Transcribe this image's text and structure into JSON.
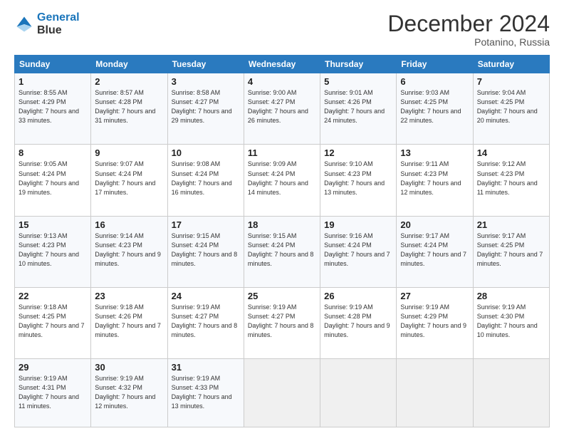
{
  "header": {
    "logo_line1": "General",
    "logo_line2": "Blue",
    "month": "December 2024",
    "location": "Potanino, Russia"
  },
  "days_of_week": [
    "Sunday",
    "Monday",
    "Tuesday",
    "Wednesday",
    "Thursday",
    "Friday",
    "Saturday"
  ],
  "weeks": [
    [
      {
        "day": "1",
        "sunrise": "8:55 AM",
        "sunset": "4:29 PM",
        "daylight": "7 hours and 33 minutes."
      },
      {
        "day": "2",
        "sunrise": "8:57 AM",
        "sunset": "4:28 PM",
        "daylight": "7 hours and 31 minutes."
      },
      {
        "day": "3",
        "sunrise": "8:58 AM",
        "sunset": "4:27 PM",
        "daylight": "7 hours and 29 minutes."
      },
      {
        "day": "4",
        "sunrise": "9:00 AM",
        "sunset": "4:27 PM",
        "daylight": "7 hours and 26 minutes."
      },
      {
        "day": "5",
        "sunrise": "9:01 AM",
        "sunset": "4:26 PM",
        "daylight": "7 hours and 24 minutes."
      },
      {
        "day": "6",
        "sunrise": "9:03 AM",
        "sunset": "4:25 PM",
        "daylight": "7 hours and 22 minutes."
      },
      {
        "day": "7",
        "sunrise": "9:04 AM",
        "sunset": "4:25 PM",
        "daylight": "7 hours and 20 minutes."
      }
    ],
    [
      {
        "day": "8",
        "sunrise": "9:05 AM",
        "sunset": "4:24 PM",
        "daylight": "7 hours and 19 minutes."
      },
      {
        "day": "9",
        "sunrise": "9:07 AM",
        "sunset": "4:24 PM",
        "daylight": "7 hours and 17 minutes."
      },
      {
        "day": "10",
        "sunrise": "9:08 AM",
        "sunset": "4:24 PM",
        "daylight": "7 hours and 16 minutes."
      },
      {
        "day": "11",
        "sunrise": "9:09 AM",
        "sunset": "4:24 PM",
        "daylight": "7 hours and 14 minutes."
      },
      {
        "day": "12",
        "sunrise": "9:10 AM",
        "sunset": "4:23 PM",
        "daylight": "7 hours and 13 minutes."
      },
      {
        "day": "13",
        "sunrise": "9:11 AM",
        "sunset": "4:23 PM",
        "daylight": "7 hours and 12 minutes."
      },
      {
        "day": "14",
        "sunrise": "9:12 AM",
        "sunset": "4:23 PM",
        "daylight": "7 hours and 11 minutes."
      }
    ],
    [
      {
        "day": "15",
        "sunrise": "9:13 AM",
        "sunset": "4:23 PM",
        "daylight": "7 hours and 10 minutes."
      },
      {
        "day": "16",
        "sunrise": "9:14 AM",
        "sunset": "4:23 PM",
        "daylight": "7 hours and 9 minutes."
      },
      {
        "day": "17",
        "sunrise": "9:15 AM",
        "sunset": "4:24 PM",
        "daylight": "7 hours and 8 minutes."
      },
      {
        "day": "18",
        "sunrise": "9:15 AM",
        "sunset": "4:24 PM",
        "daylight": "7 hours and 8 minutes."
      },
      {
        "day": "19",
        "sunrise": "9:16 AM",
        "sunset": "4:24 PM",
        "daylight": "7 hours and 7 minutes."
      },
      {
        "day": "20",
        "sunrise": "9:17 AM",
        "sunset": "4:24 PM",
        "daylight": "7 hours and 7 minutes."
      },
      {
        "day": "21",
        "sunrise": "9:17 AM",
        "sunset": "4:25 PM",
        "daylight": "7 hours and 7 minutes."
      }
    ],
    [
      {
        "day": "22",
        "sunrise": "9:18 AM",
        "sunset": "4:25 PM",
        "daylight": "7 hours and 7 minutes."
      },
      {
        "day": "23",
        "sunrise": "9:18 AM",
        "sunset": "4:26 PM",
        "daylight": "7 hours and 7 minutes."
      },
      {
        "day": "24",
        "sunrise": "9:19 AM",
        "sunset": "4:27 PM",
        "daylight": "7 hours and 8 minutes."
      },
      {
        "day": "25",
        "sunrise": "9:19 AM",
        "sunset": "4:27 PM",
        "daylight": "7 hours and 8 minutes."
      },
      {
        "day": "26",
        "sunrise": "9:19 AM",
        "sunset": "4:28 PM",
        "daylight": "7 hours and 9 minutes."
      },
      {
        "day": "27",
        "sunrise": "9:19 AM",
        "sunset": "4:29 PM",
        "daylight": "7 hours and 9 minutes."
      },
      {
        "day": "28",
        "sunrise": "9:19 AM",
        "sunset": "4:30 PM",
        "daylight": "7 hours and 10 minutes."
      }
    ],
    [
      {
        "day": "29",
        "sunrise": "9:19 AM",
        "sunset": "4:31 PM",
        "daylight": "7 hours and 11 minutes."
      },
      {
        "day": "30",
        "sunrise": "9:19 AM",
        "sunset": "4:32 PM",
        "daylight": "7 hours and 12 minutes."
      },
      {
        "day": "31",
        "sunrise": "9:19 AM",
        "sunset": "4:33 PM",
        "daylight": "7 hours and 13 minutes."
      },
      null,
      null,
      null,
      null
    ]
  ]
}
